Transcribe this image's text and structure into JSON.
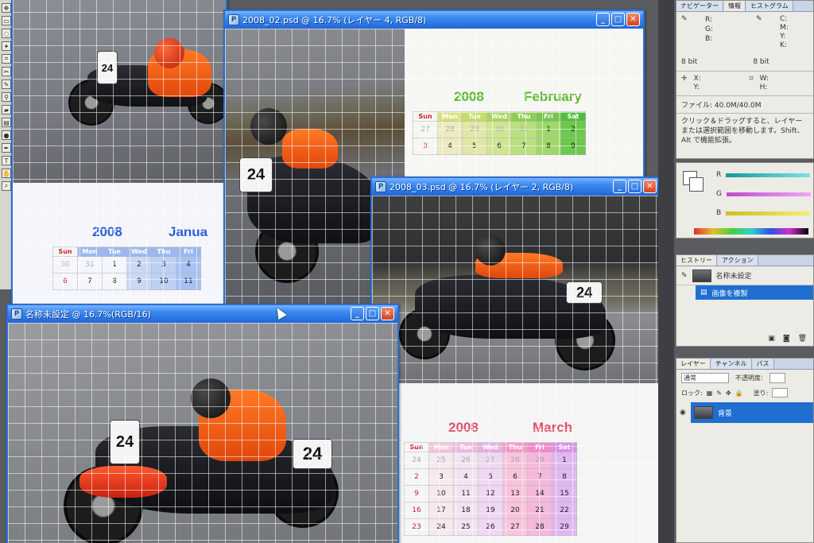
{
  "colors": {
    "title_bar": "#2166d8",
    "selection": "#1f6fd1",
    "feb_accent": "#59b82a",
    "mar_accent": "#e0506a",
    "jan_accent": "#2a5cd6"
  },
  "windows": {
    "january": {
      "year": "2008",
      "month": "Janua",
      "weekdays": [
        "Sun",
        "Mon",
        "Tue",
        "Wed",
        "Thu",
        "Fri"
      ],
      "weeks": [
        [
          "30",
          "31",
          "1",
          "2",
          "3",
          "4"
        ],
        [
          "6",
          "7",
          "8",
          "9",
          "10",
          "11"
        ]
      ],
      "plate": "24"
    },
    "february": {
      "title": "2008_02.psd @ 16.7% (レイヤー 4, RGB/8)",
      "year": "2008",
      "month": "February",
      "weekdays": [
        "Sun",
        "Mon",
        "Tue",
        "Wed",
        "Thu",
        "Fri",
        "Sat"
      ],
      "weeks": [
        [
          "27",
          "28",
          "29",
          "30",
          "31",
          "1",
          "2"
        ],
        [
          "3",
          "4",
          "5",
          "6",
          "7",
          "8",
          "9"
        ]
      ],
      "plate": "24"
    },
    "march": {
      "title": "2008_03.psd @ 16.7% (レイヤー 2, RGB/8)",
      "year": "2008",
      "month": "March",
      "weekdays": [
        "Sun",
        "Mon",
        "Tue",
        "Wed",
        "Thu",
        "Fri",
        "Sat"
      ],
      "weeks": [
        [
          "24",
          "25",
          "26",
          "27",
          "28",
          "29",
          "1"
        ],
        [
          "2",
          "3",
          "4",
          "5",
          "6",
          "7",
          "8"
        ],
        [
          "9",
          "10",
          "11",
          "12",
          "13",
          "14",
          "15"
        ],
        [
          "16",
          "17",
          "18",
          "19",
          "20",
          "21",
          "22"
        ],
        [
          "23",
          "24",
          "25",
          "26",
          "27",
          "28",
          "29"
        ]
      ],
      "plate": "24"
    },
    "untitled": {
      "title": "名称未設定 @ 16.7%(RGB/16)",
      "plate_front": "24",
      "plate_side": "24"
    }
  },
  "info_panel": {
    "tabs": [
      "ナビゲーター",
      "情報",
      "ヒストグラム"
    ],
    "r_label": "R:",
    "g_label": "G:",
    "b_label": "B:",
    "c_label": "C:",
    "m_label": "M:",
    "y_label": "Y:",
    "k_label": "K:",
    "bit_left": "8 bit",
    "bit_right": "8 bit",
    "x_label": "X:",
    "y2_label": "Y:",
    "w_label": "W:",
    "h_label": "H:",
    "file_size": "ファイル: 40.0M/40.0M",
    "hint": "クリック＆ドラッグすると、レイヤーまたは選択範囲を移動します。Shift、Alt で機能拡張。"
  },
  "color_panel": {
    "r_label": "R",
    "g_label": "G",
    "b_label": "B"
  },
  "history_panel": {
    "tabs": [
      "ヒストリー",
      "アクション"
    ],
    "items": [
      "名称未設定",
      "画像を複製"
    ]
  },
  "layers_panel": {
    "tabs": [
      "レイヤー",
      "チャンネル",
      "パス"
    ],
    "blend_mode": "通常",
    "opacity_label": "不透明度:",
    "lock_label": "ロック:",
    "fill_label": "塗り:",
    "layer_name": "背景"
  }
}
